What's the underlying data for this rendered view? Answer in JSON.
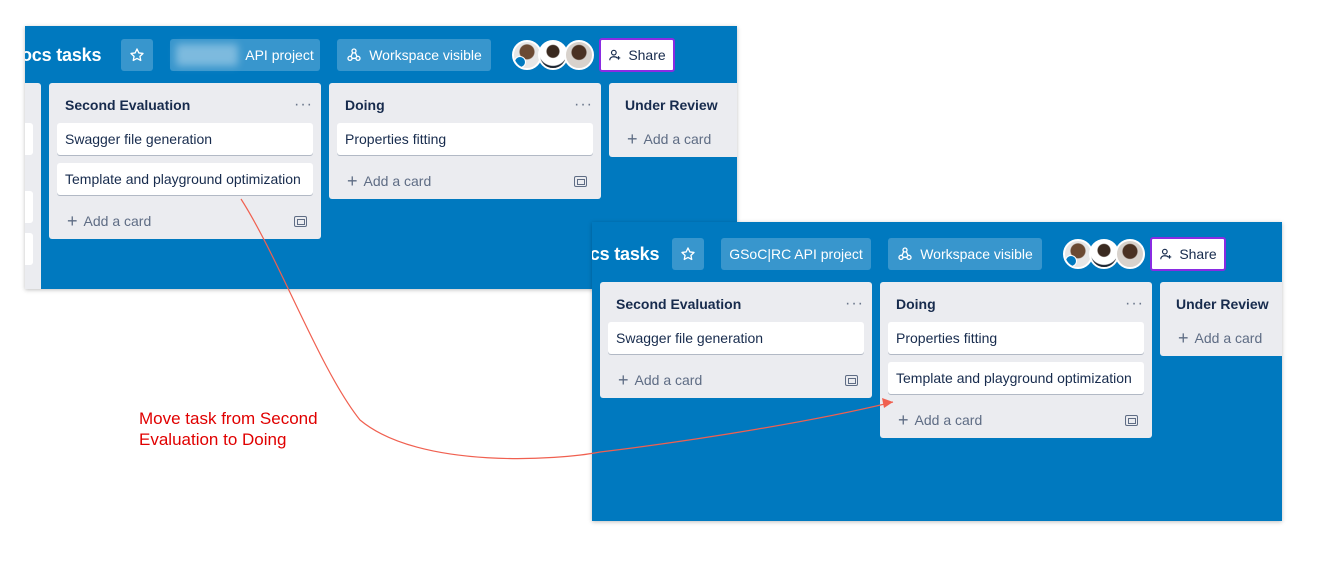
{
  "before": {
    "board_title": "ocs tasks",
    "project_button": "API project",
    "visibility_button": "Workspace visible",
    "share_label": "Share",
    "lists": [
      {
        "title": "Second Evaluation",
        "cards": [
          "Swagger file generation",
          "Template and playground optimization"
        ],
        "add_label": "Add a card"
      },
      {
        "title": "Doing",
        "cards": [
          "Properties fitting"
        ],
        "add_label": "Add a card"
      },
      {
        "title": "Under Review",
        "cards": [],
        "add_label": "Add a card"
      }
    ]
  },
  "after": {
    "board_title": "ocs tasks",
    "project_button": "GSoC|RC API project",
    "visibility_button": "Workspace visible",
    "share_label": "Share",
    "lists": [
      {
        "title": "Second Evaluation",
        "cards": [
          "Swagger file generation"
        ],
        "add_label": "Add a card"
      },
      {
        "title": "Doing",
        "cards": [
          "Properties fitting",
          "Template and playground optimization"
        ],
        "add_label": "Add a card"
      },
      {
        "title": "Under Review",
        "cards": [],
        "add_label": "Add a card"
      }
    ]
  },
  "annotation": {
    "line1": "Move task from Second",
    "line2": "Evaluation to Doing",
    "color": "#e00000"
  },
  "colors": {
    "board_background": "#0079bf",
    "list_background": "#ebecf0",
    "share_border": "#8a2be2"
  },
  "icons": {
    "star": "star-icon",
    "visibility": "workspace-icon",
    "share": "add-person-icon",
    "list_menu": "ellipsis-icon",
    "template": "card-template-icon"
  }
}
